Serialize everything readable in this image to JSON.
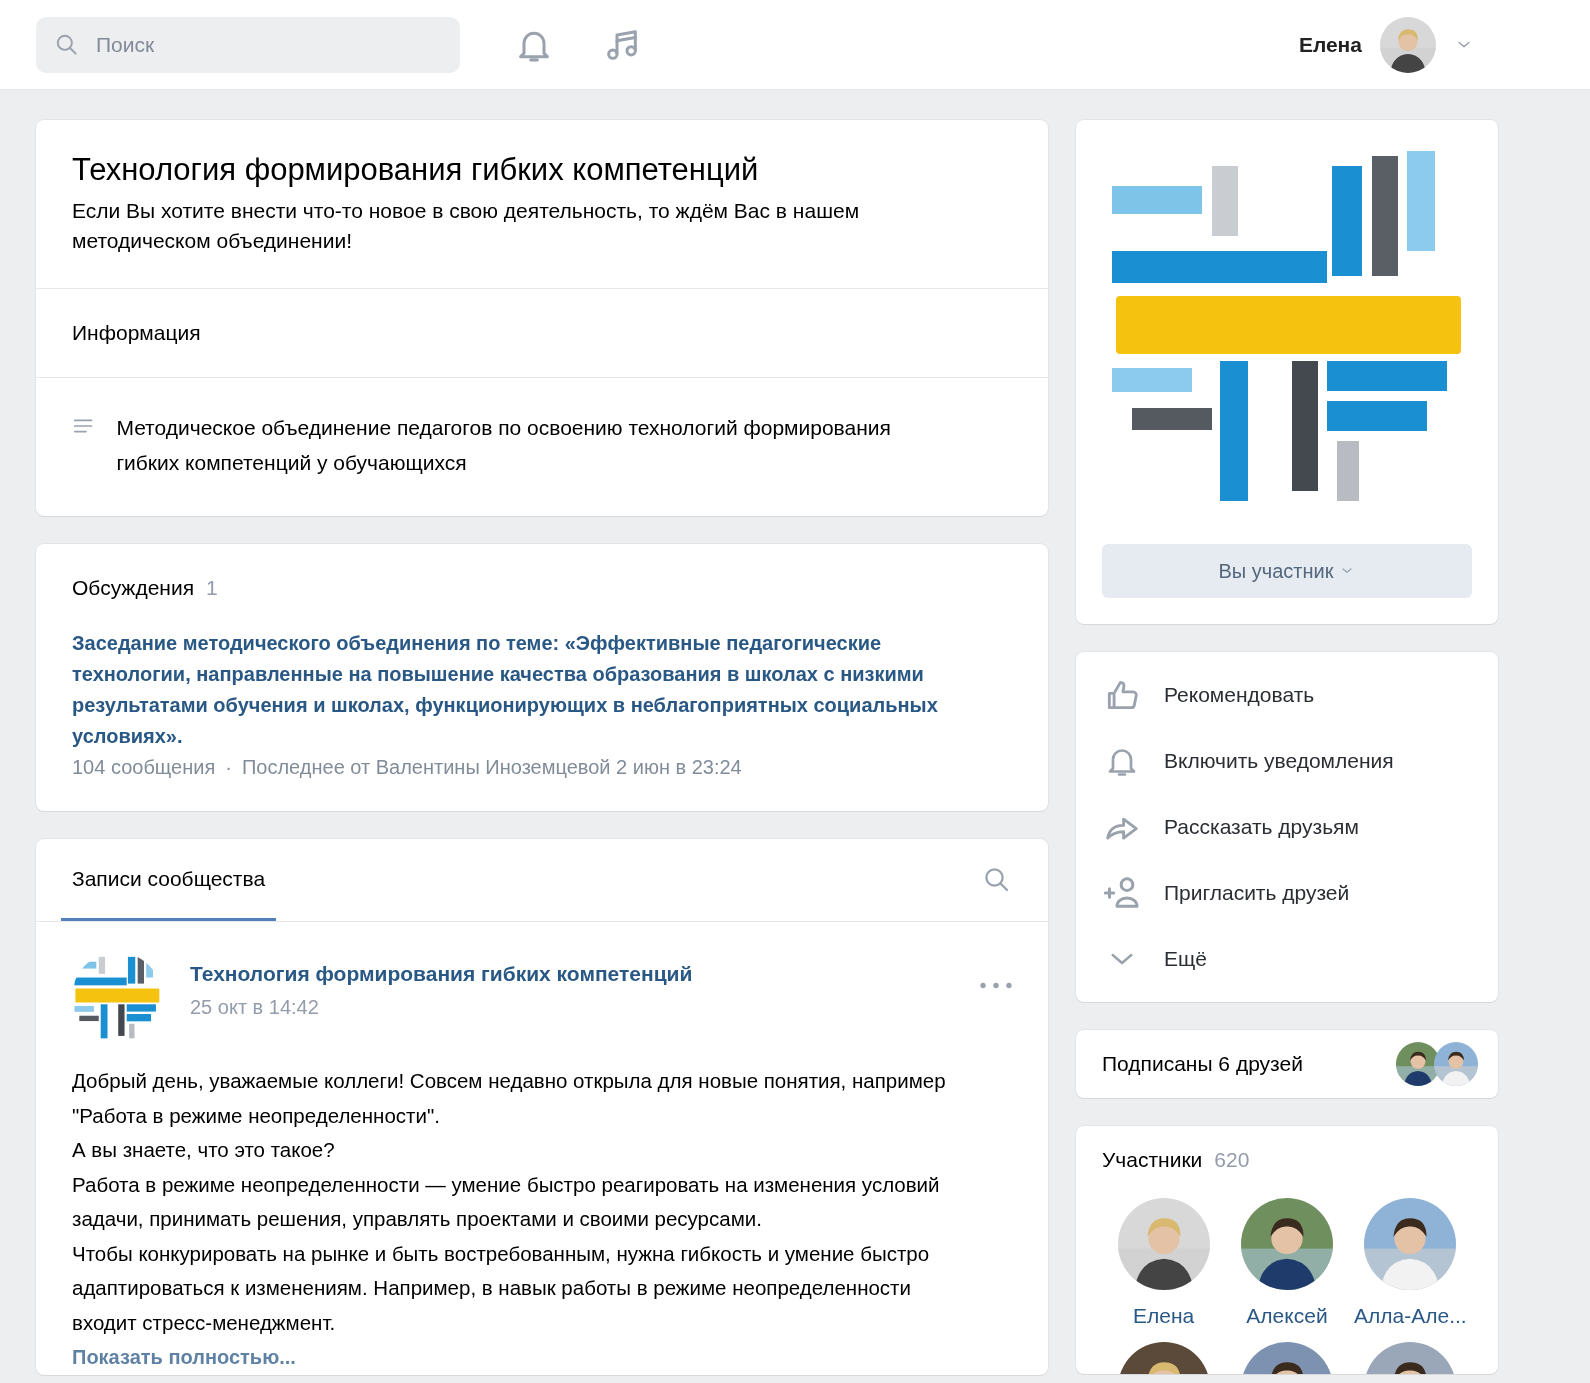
{
  "header": {
    "search": {
      "placeholder": "Поиск"
    },
    "user_name": "Елена"
  },
  "group": {
    "title": "Технология формирования гибких компетенций",
    "status": "Если Вы хотите внести что-то новое в свою деятельность, то ждём Вас в нашем методическом объединении!",
    "info_heading": "Информация",
    "description": "Методическое объединение педагогов по освоению технологий формирования гибких компетенций у обучающихся"
  },
  "discussions": {
    "heading": "Обсуждения",
    "count": "1",
    "topic": "Заседание методического объединения по теме: «Эффективные педагогические технологии, направленные на повышение качества образования в школах с низкими результатами обучения и школах, функционирующих в неблагоприятных социальных условиях».",
    "messages": "104 сообщения",
    "separator": "·",
    "last": "Последнее от Валентины Иноземцевой 2 июн в 23:24"
  },
  "wall": {
    "tabs": [
      {
        "label": "Записи сообщества",
        "selected": true
      }
    ],
    "post": {
      "author": "Технология формирования гибких компетенций",
      "date": "25 окт в 14:42",
      "paragraphs": [
        "Добрый день, уважаемые коллеги! Совсем недавно открыла для новые понятия, например \"Работа в режиме неопределенности\".",
        "А вы знаете, что это такое?",
        "Работа в режиме неопределенности — умение быстро реагировать на изменения условий задачи, принимать решения, управлять проектами и своими ресурсами.",
        "Чтобы конкурировать на рынке и быть востребованным, нужна гибкость и умение быстро адаптироваться к изменениям. Например, в навык работы в режиме неопределенности входит стресс-менеджмент."
      ],
      "more": "Показать полностью..."
    }
  },
  "cover": {
    "kind": "picture",
    "button": "Вы участник"
  },
  "actions": [
    {
      "kind": "thumb",
      "label": "Рекомендовать"
    },
    {
      "kind": "bell",
      "label": "Включить уведомления"
    },
    {
      "kind": "share",
      "label": "Рассказать друзьям"
    },
    {
      "kind": "invite",
      "label": "Пригласить друзей"
    },
    {
      "kind": "more",
      "label": "Ещё"
    }
  ],
  "friends": {
    "label": "Подписаны 6 друзей"
  },
  "members": {
    "heading": "Участники",
    "count": "620",
    "people": [
      {
        "name": "Елена"
      },
      {
        "name": "Алексей"
      },
      {
        "name": "Алла-Але..."
      }
    ]
  }
}
